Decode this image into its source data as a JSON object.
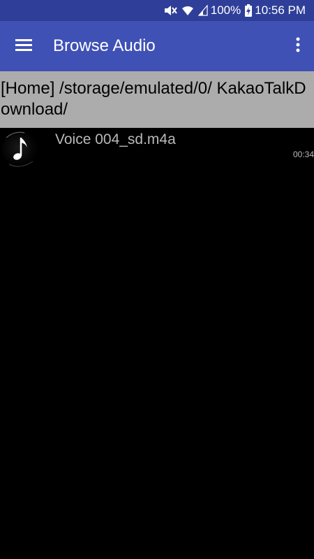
{
  "status_bar": {
    "battery": "100%",
    "time": "10:56 PM",
    "icons": [
      "mute-icon",
      "wifi-icon",
      "signal-icon",
      "battery-charging-icon"
    ]
  },
  "app_bar": {
    "title": "Browse Audio",
    "menu_icon": "hamburger-menu-icon",
    "overflow_icon": "overflow-menu-icon"
  },
  "path": {
    "text": "[Home] /storage/emulated/0/ KakaoTalkDownload/"
  },
  "files": [
    {
      "name": "Voice 004_sd.m4a",
      "duration": "00:34",
      "icon": "music-note-icon"
    }
  ],
  "colors": {
    "status_bar": "#2f3f99",
    "app_bar": "#3f51b5",
    "path_bar": "#acacac",
    "background": "#000000",
    "list_text": "#b9b9b9"
  }
}
